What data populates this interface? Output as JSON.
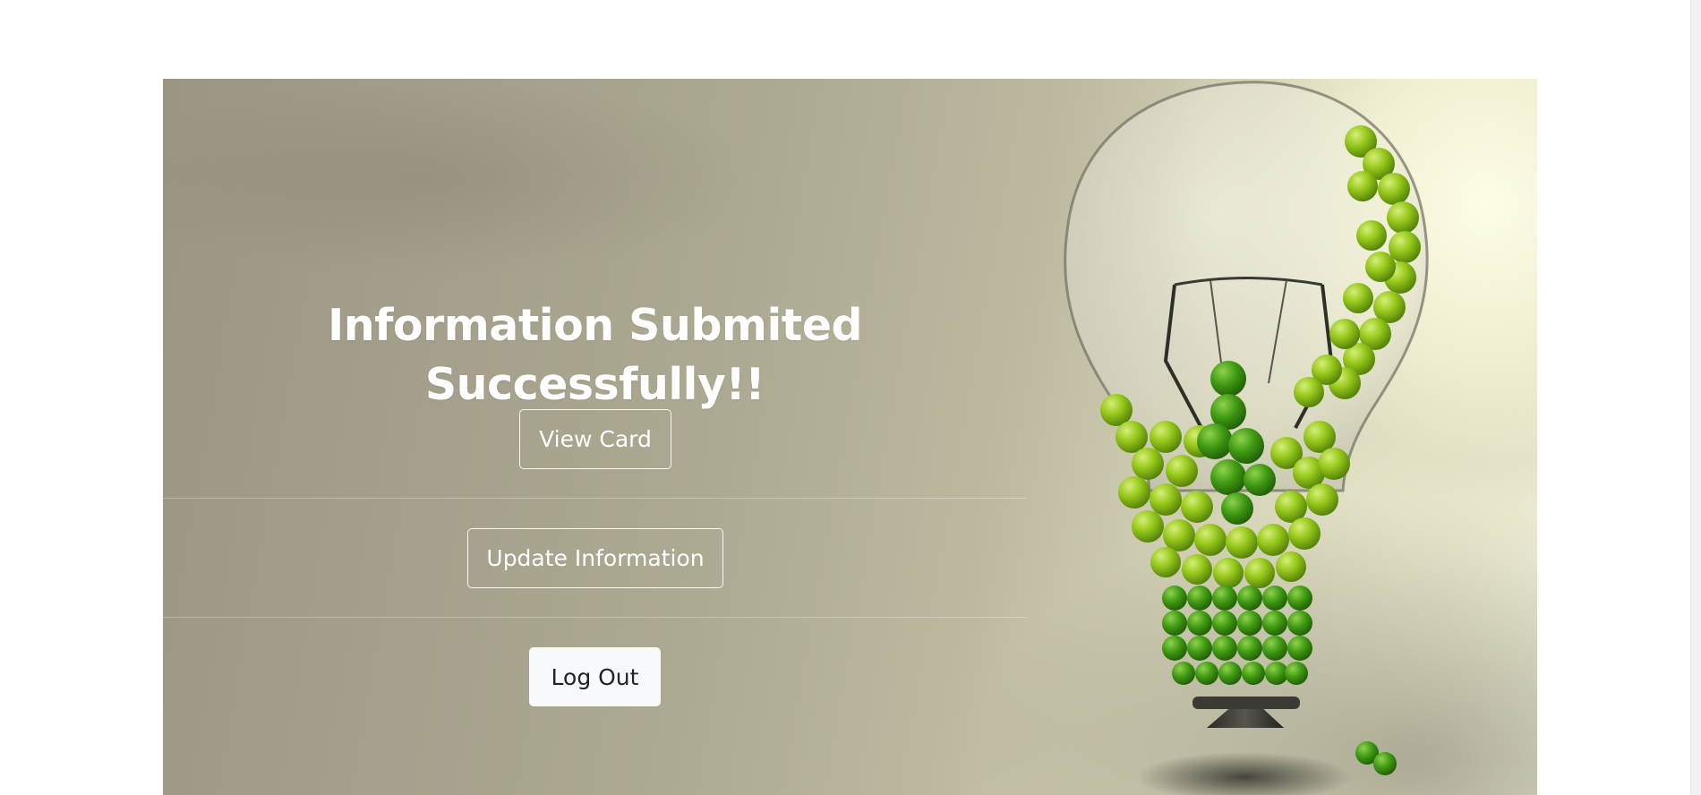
{
  "hero": {
    "headline": "Information Submited Successfully!!",
    "image_subject": "lightbulb-filled-with-green-apples"
  },
  "actions": {
    "view_card_label": "View Card",
    "update_information_label": "Update Information",
    "log_out_label": "Log Out"
  },
  "colors": {
    "headline_text": "#ffffff",
    "outline_button_border": "#ffffff",
    "light_button_bg": "#f8f9fa",
    "light_button_text": "#212529",
    "apple_green": "#7fb812"
  }
}
